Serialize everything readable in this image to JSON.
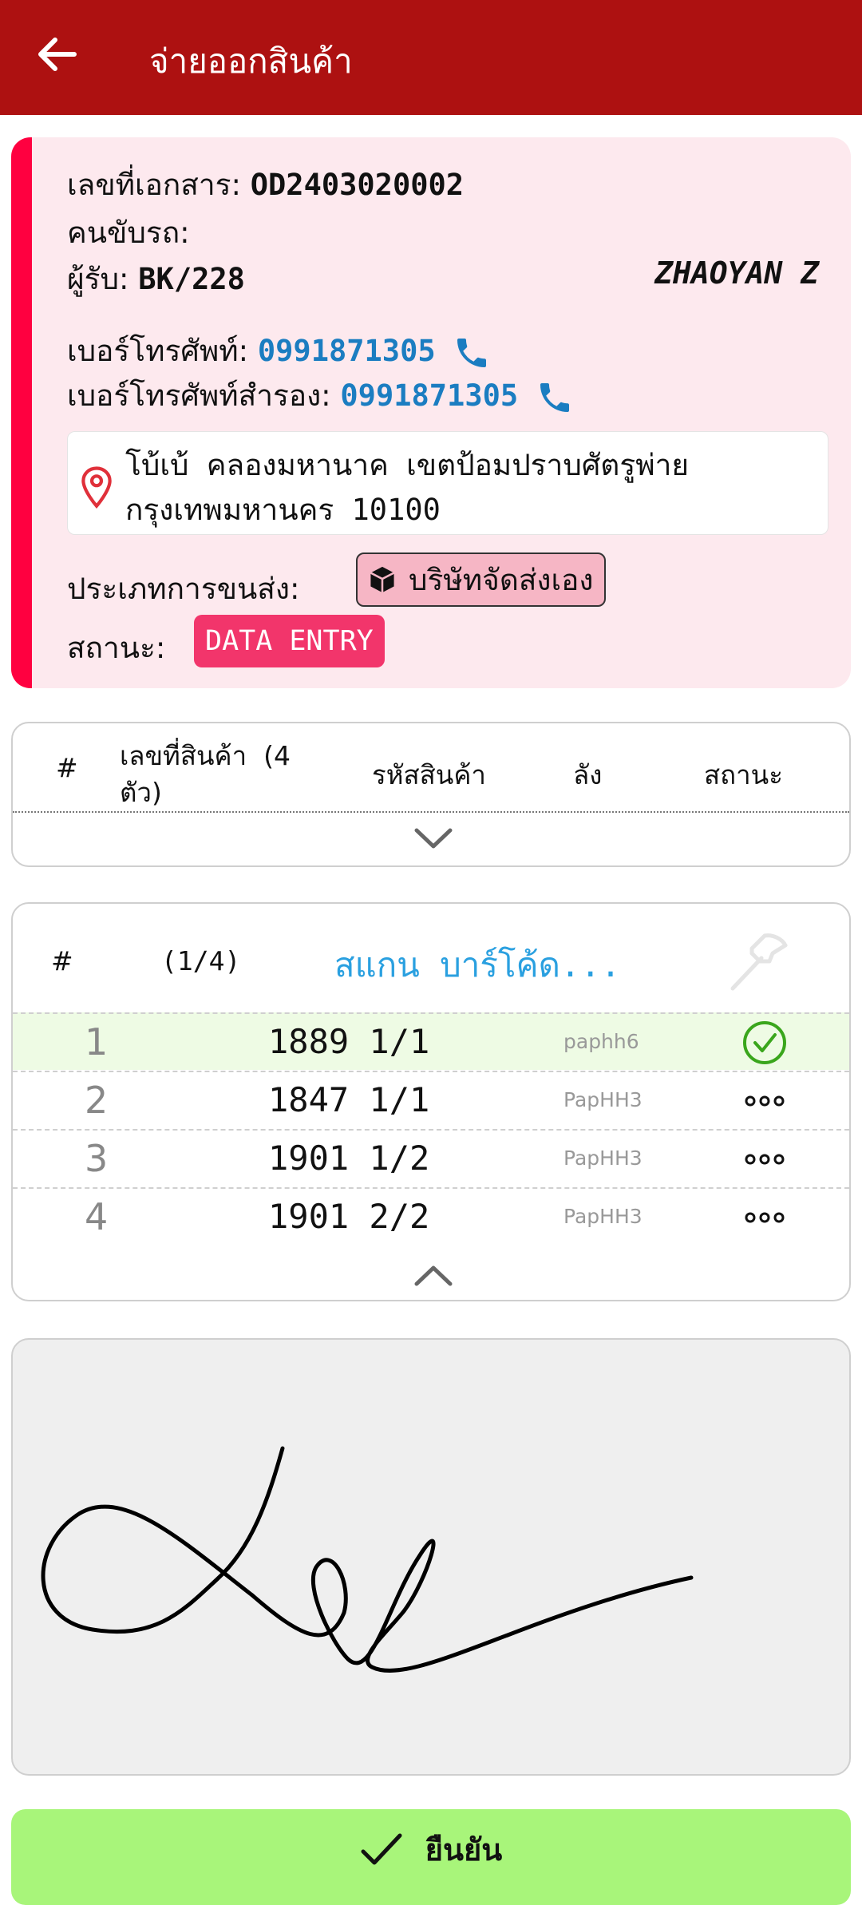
{
  "appbar": {
    "title": "จ่ายออกสินค้า"
  },
  "doc": {
    "doc_no_label": "เลขที่เอกสาร:",
    "doc_no": "OD2403020002",
    "driver_label": "คนขับรถ:",
    "driver": "",
    "receiver_label": "ผู้รับ:",
    "receiver_code": "BK/228",
    "receiver_name": "ZHAOYAN Z",
    "phone_label": "เบอร์โทรศัพท์:",
    "phone": "0991871305",
    "phone2_label": "เบอร์โทรศัพท์สำรอง:",
    "phone2": "0991871305",
    "address_line1": "โบ้เบ้ คลองมหานาค เขตป้อมปราบศัตรูพ่าย",
    "address_line2": "กรุงเทพมหานคร 10100",
    "shipping_label": "ประเภทการขนส่ง:",
    "shipping_value": "บริษัทจัดส่งเอง",
    "status_label": "สถานะ:",
    "status_value": "DATA ENTRY",
    "colors": {
      "stripe": "#ff0040",
      "phone": "#1b7dc1",
      "status": "#f2356b"
    }
  },
  "items_table": {
    "col_index": "#",
    "col_product_no_line1": "เลขที่สินค้า  (4",
    "col_product_no_line2": "ตัว)",
    "col_product_code": "รหัสสินค้า",
    "col_box": "ลัง",
    "col_status": "สถานะ"
  },
  "scan_table": {
    "col_index": "#",
    "progress": "(1/4)",
    "scan_placeholder": "สแกน บาร์โค้ด...",
    "rows": [
      {
        "num": "1",
        "no": "1889 1/1",
        "code": "paphh6",
        "status": "scanned"
      },
      {
        "num": "2",
        "no": "1847 1/1",
        "code": "PapHH3",
        "status": "pending"
      },
      {
        "num": "3",
        "no": "1901 1/2",
        "code": "PapHH3",
        "status": "pending"
      },
      {
        "num": "4",
        "no": "1901 2/2",
        "code": "PapHH3",
        "status": "pending"
      }
    ]
  },
  "confirm": {
    "label": "ยืนยัน",
    "color": "#a8f57a"
  }
}
